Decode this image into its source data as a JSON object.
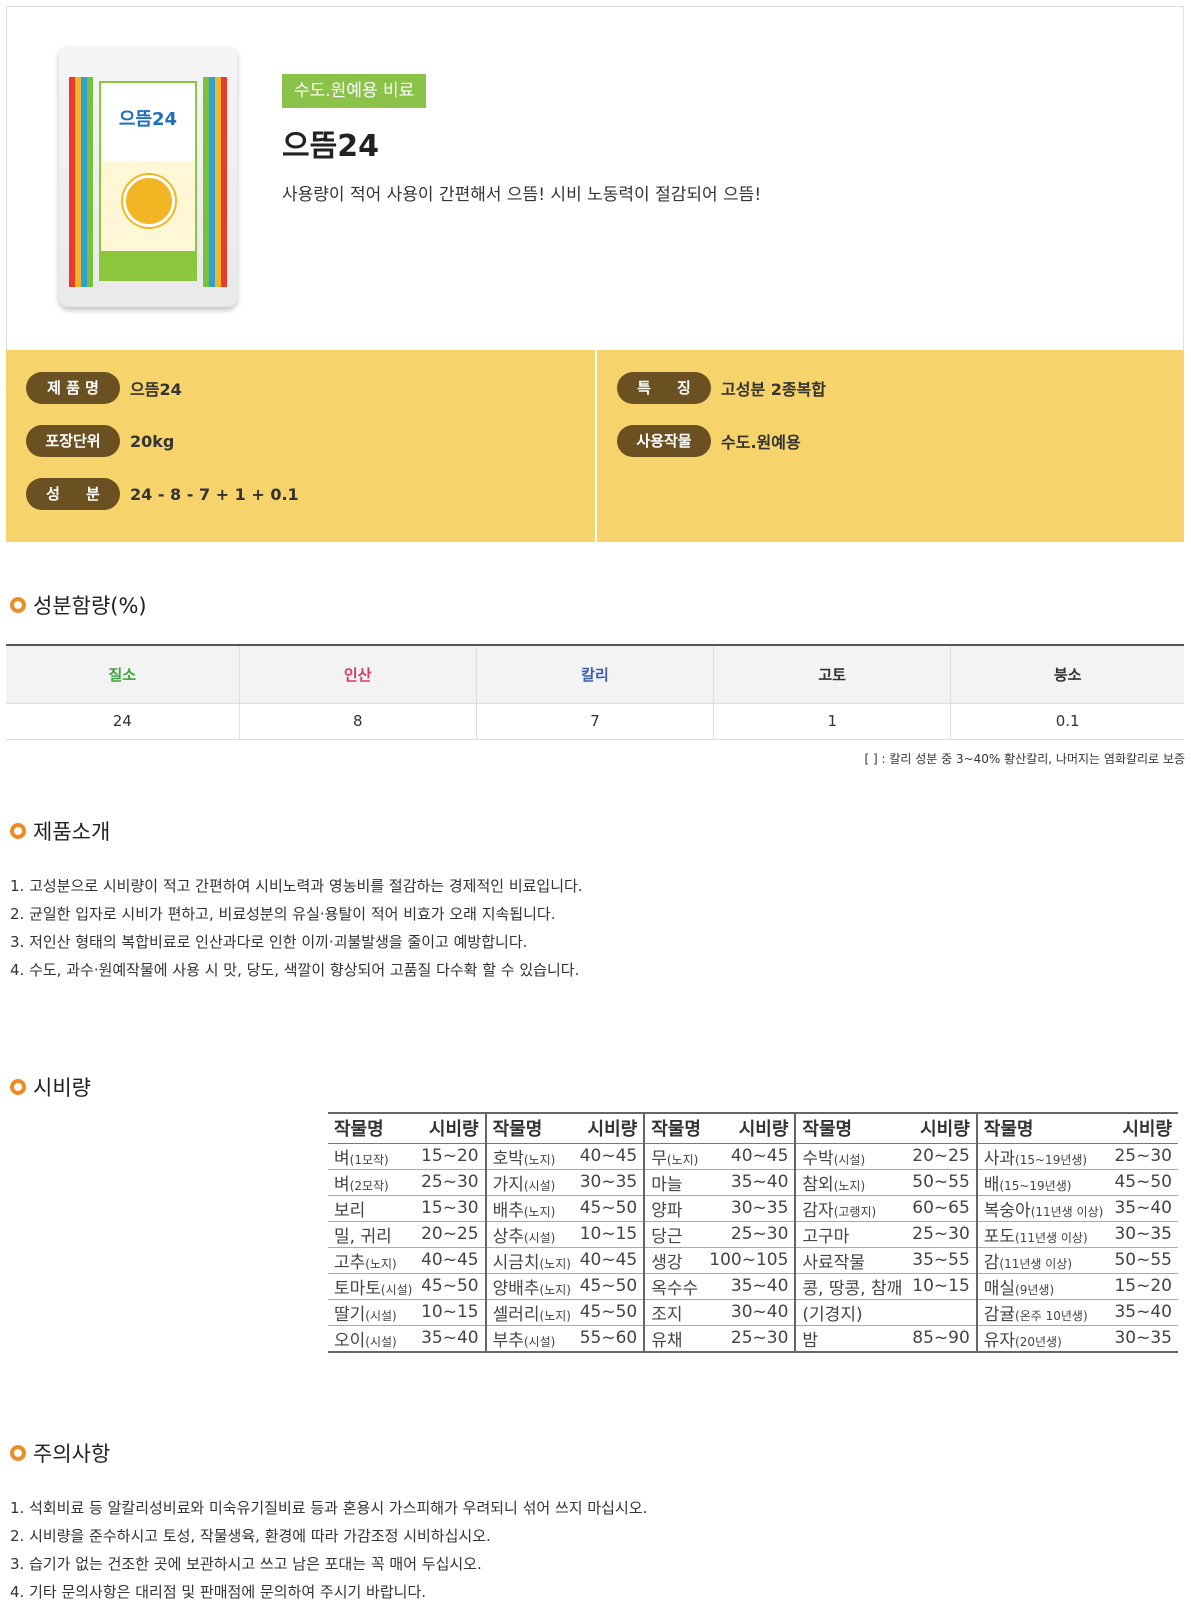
{
  "product": {
    "category": "수도.원예용 비료",
    "name": "으뜸24",
    "description": "사용량이 적어 사용이 간편해서 으뜸! 시비 노동력이 절감되어 으뜸!",
    "bag_label": "으뜸24"
  },
  "specs": {
    "left": [
      {
        "label": "제 품 명",
        "value": "으뜸24"
      },
      {
        "label": "포장단위",
        "value": "20kg"
      },
      {
        "label": "성     분",
        "value": "24 - 8 - 7 + 1 + 0.1"
      }
    ],
    "right": [
      {
        "label": "특     징",
        "value": "고성분 2종복합"
      },
      {
        "label": "사용작물",
        "value": "수도.원예용"
      }
    ]
  },
  "sections": {
    "composition": "성분함량(%)",
    "intro": "제품소개",
    "dosage": "시비량",
    "caution": "주의사항"
  },
  "composition": {
    "headers": [
      "질소",
      "인산",
      "칼리",
      "고토",
      "붕소"
    ],
    "header_colors": [
      "#3aa63a",
      "#d63a6b",
      "#3a5fb0",
      "#333333",
      "#333333"
    ],
    "values": [
      "24",
      "8",
      "7",
      "1",
      "0.1"
    ],
    "note": "[ ] : 칼리 성분 중 3~40% 황산칼리, 나머지는 염화칼리로 보증"
  },
  "intro_items": [
    "1. 고성분으로 시비량이 적고 간편하여 시비노력과 영농비를 절감하는 경제적인 비료입니다.",
    "2. 균일한 입자로 시비가 편하고, 비료성분의 유실·용탈이 적어 비효가 오래 지속됩니다.",
    "3. 저인산 형태의 복합비료로 인산과다로 인한 이끼·괴불발생을 줄이고 예방합니다.",
    "4. 수도, 과수·원예작물에 사용 시 맛, 당도, 색깔이 향상되어 고품질 다수확 할 수 있습니다."
  ],
  "dosage": {
    "headers": [
      "작물명",
      "시비량",
      "작물명",
      "시비량",
      "작물명",
      "시비량",
      "작물명",
      "시비량",
      "작물명",
      "시비량"
    ],
    "rows": [
      [
        [
          "벼",
          "(1모작)"
        ],
        "15~20",
        [
          "호박",
          "(노지)"
        ],
        "40~45",
        [
          "무",
          "(노지)"
        ],
        "40~45",
        [
          "수박",
          "(시설)"
        ],
        "20~25",
        [
          "사과",
          "(15~19년생)"
        ],
        "25~30"
      ],
      [
        [
          "벼",
          "(2모작)"
        ],
        "25~30",
        [
          "가지",
          "(시설)"
        ],
        "30~35",
        [
          "마늘",
          ""
        ],
        "35~40",
        [
          "참외",
          "(노지)"
        ],
        "50~55",
        [
          "배",
          "(15~19년생)"
        ],
        "45~50"
      ],
      [
        [
          "보리",
          ""
        ],
        "15~30",
        [
          "배추",
          "(노지)"
        ],
        "45~50",
        [
          "양파",
          ""
        ],
        "30~35",
        [
          "감자",
          "(고랭지)"
        ],
        "60~65",
        [
          "복숭아",
          "(11년생 이상)"
        ],
        "35~40"
      ],
      [
        [
          "밀, 귀리",
          ""
        ],
        "20~25",
        [
          "상추",
          "(시설)"
        ],
        "10~15",
        [
          "당근",
          ""
        ],
        "25~30",
        [
          "고구마",
          ""
        ],
        "25~30",
        [
          "포도",
          "(11년생 이상)"
        ],
        "30~35"
      ],
      [
        [
          "고추",
          "(노지)"
        ],
        "40~45",
        [
          "시금치",
          "(노지)"
        ],
        "40~45",
        [
          "생강",
          ""
        ],
        "100~105",
        [
          "사료작물",
          ""
        ],
        "35~55",
        [
          "감",
          "(11년생 이상)"
        ],
        "50~55"
      ],
      [
        [
          "토마토",
          "(시설)"
        ],
        "45~50",
        [
          "양배추",
          "(노지)"
        ],
        "45~50",
        [
          "옥수수",
          ""
        ],
        "35~40",
        [
          "콩, 땅콩, 참깨",
          ""
        ],
        "10~15",
        [
          "매실",
          "(9년생)"
        ],
        "15~20"
      ],
      [
        [
          "딸기",
          "(시설)"
        ],
        "10~15",
        [
          "셀러리",
          "(노지)"
        ],
        "45~50",
        [
          "조지",
          ""
        ],
        "30~40",
        [
          "(기경지)",
          ""
        ],
        "",
        [
          "감귤",
          "(온주 10년생)"
        ],
        "35~40"
      ],
      [
        [
          "오이",
          "(시설)"
        ],
        "35~40",
        [
          "부추",
          "(시설)"
        ],
        "55~60",
        [
          "유채",
          ""
        ],
        "25~30",
        [
          "밤",
          ""
        ],
        "85~90",
        [
          "유자",
          "(20년생)"
        ],
        "30~35"
      ]
    ]
  },
  "caution_items": [
    "1. 석회비료 등 알칼리성비료와 미숙유기질비료 등과 혼용시 가스피해가 우려되니 섞어 쓰지 마십시오.",
    "2. 시비량을 준수하시고 토성, 작물생육, 환경에 따라 가감조정 시비하십시오.",
    "3. 습기가 없는 건조한 곳에 보관하시고 쓰고 남은 포대는 꼭 매어 두십시오.",
    "4. 기타 문의사항은 대리점 및 판매점에 문의하여 주시기 바랍니다."
  ]
}
